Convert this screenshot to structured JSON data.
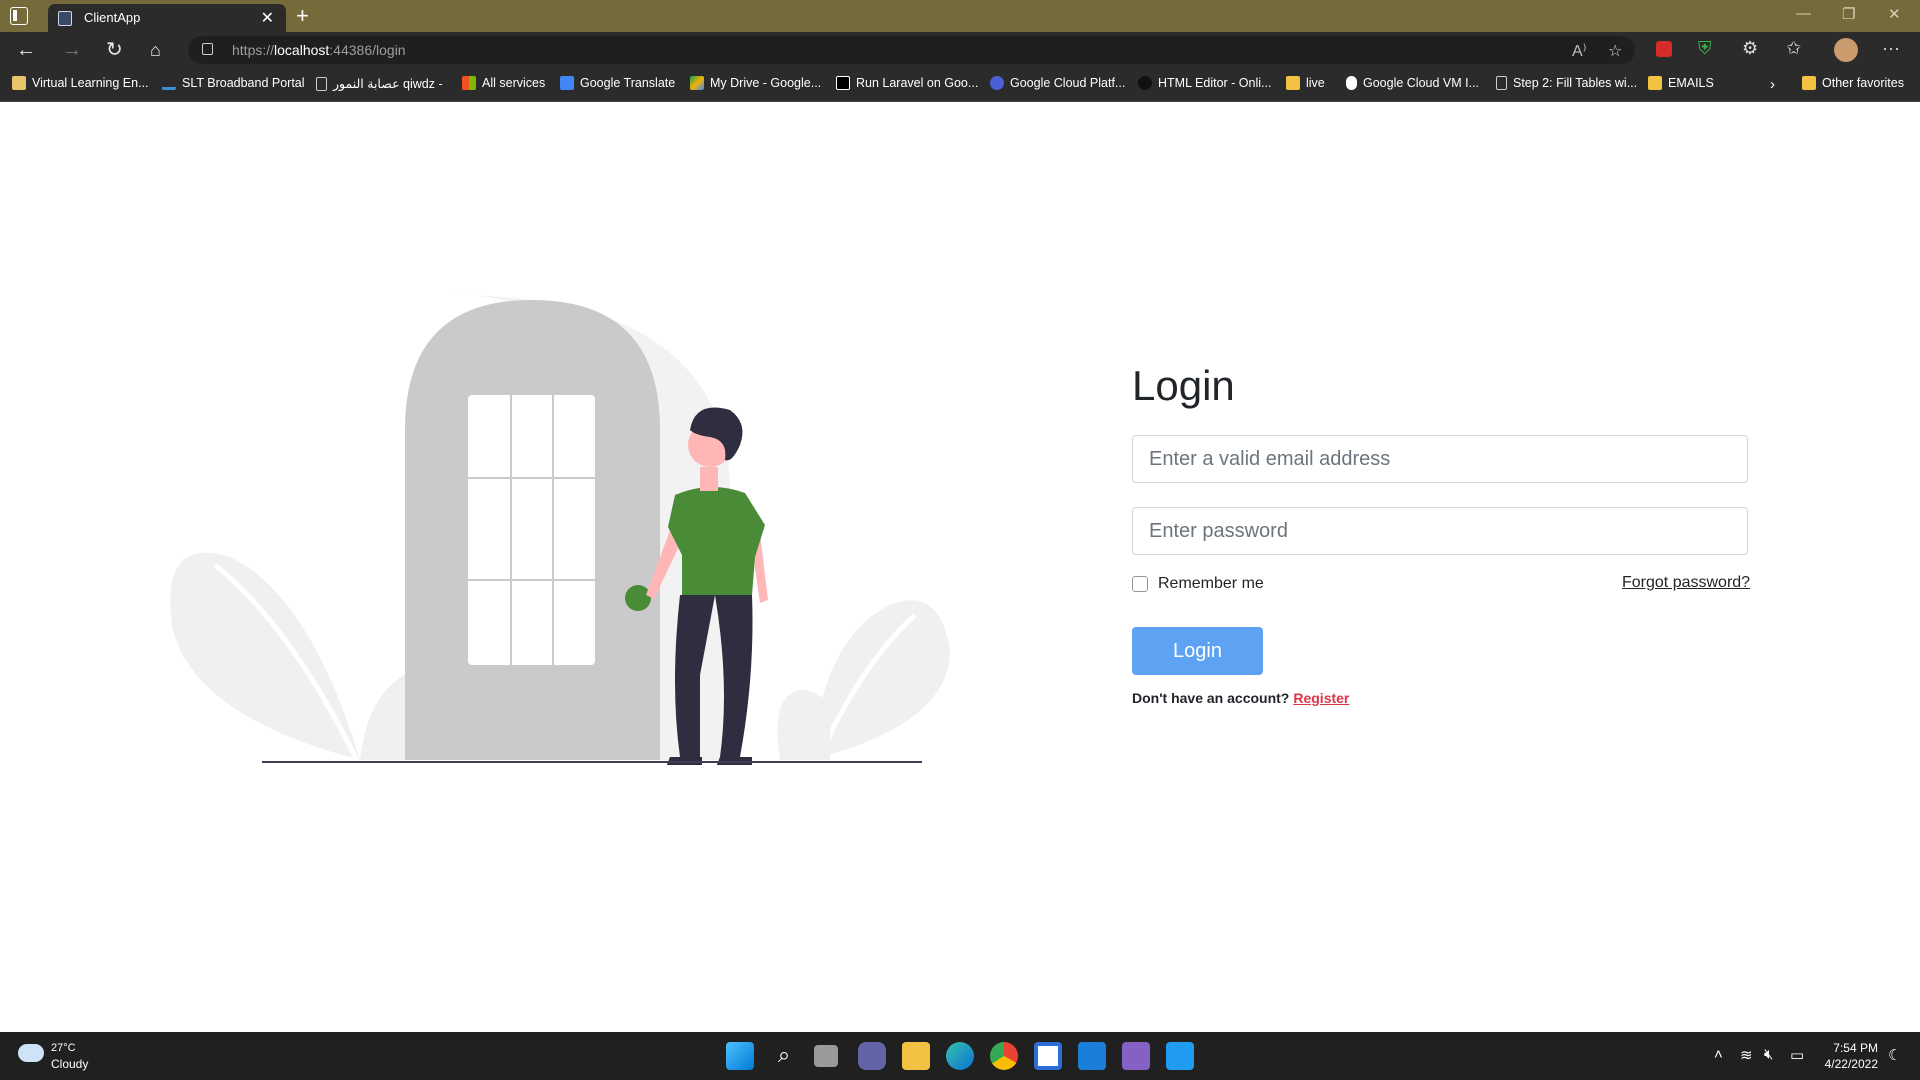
{
  "browser": {
    "tab_title": "ClientApp",
    "url_prefix": "https://",
    "url_host": "localhost",
    "url_rest": ":44386/login",
    "bookmarks": [
      "Virtual Learning En...",
      "SLT Broadband Portal",
      "عصابة النمور qiwdz -",
      "All services",
      "Google Translate",
      "My Drive - Google...",
      "Run Laravel on Goo...",
      "Google Cloud Platf...",
      "HTML Editor - Onli...",
      "live",
      "Google Cloud VM I...",
      "Step 2: Fill Tables wi...",
      "EMAILS"
    ],
    "other_favorites": "Other favorites"
  },
  "login": {
    "title": "Login",
    "email_placeholder": "Enter a valid email address",
    "password_placeholder": "Enter password",
    "remember_label": "Remember me",
    "forgot_label": "Forgot password?",
    "button_label": "Login",
    "no_account_text": "Don't have an account?",
    "register_label": "Register"
  },
  "taskbar": {
    "weather_temp": "27°C",
    "weather_desc": "Cloudy",
    "time": "7:54 PM",
    "date": "4/22/2022"
  },
  "colors": {
    "titlebar": "#756a39",
    "browser_chrome": "#2b2b2b",
    "primary_button": "#5da2f3",
    "register_link": "#dc3545",
    "shirt": "#4a8b37"
  }
}
